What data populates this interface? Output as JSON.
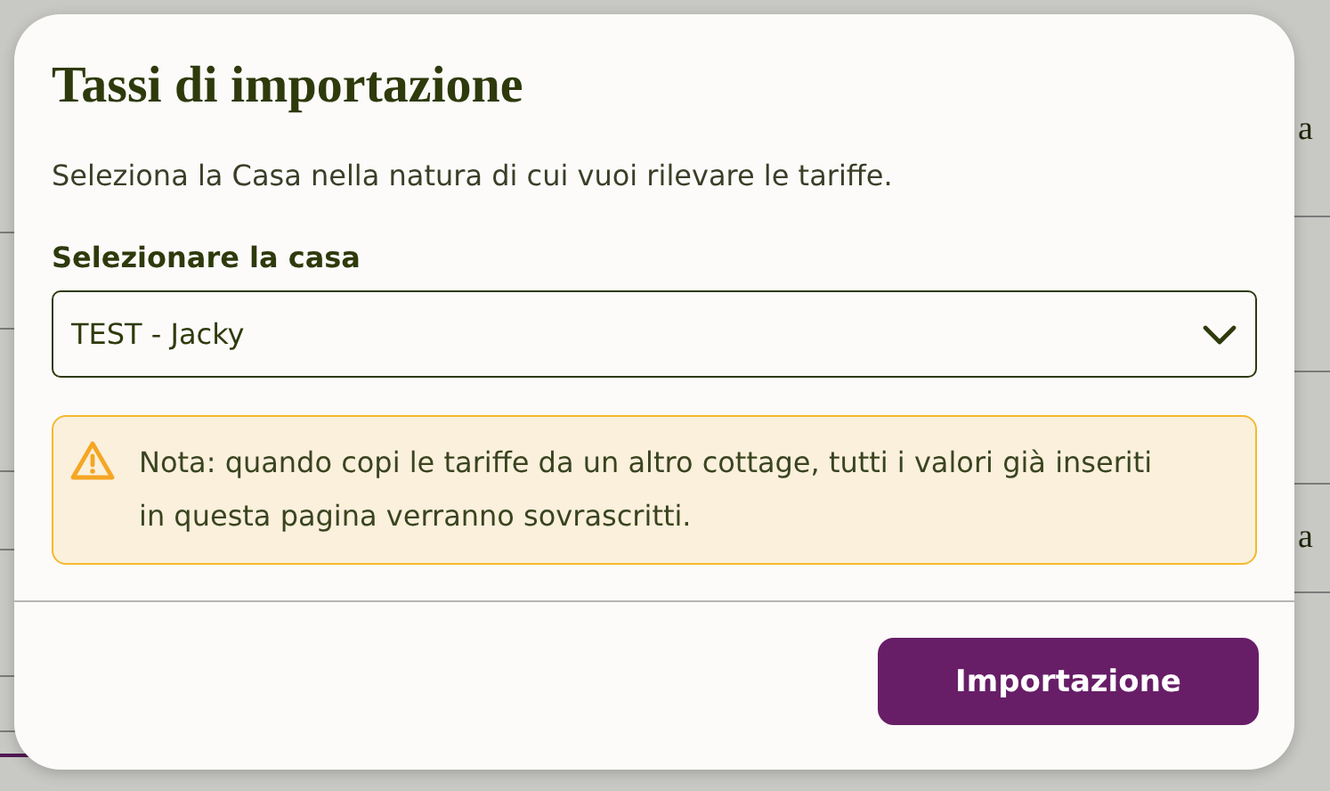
{
  "background": {
    "right_rows": [
      {
        "text": "a"
      },
      {},
      {},
      {
        "text": "a"
      }
    ]
  },
  "dialog": {
    "title": "Tassi di importazione",
    "description": "Seleziona la Casa nella natura di cui vuoi rilevare le tariffe.",
    "select": {
      "label": "Selezionare la casa",
      "value": "TEST - Jacky"
    },
    "note": "Nota: quando copi le tariffe da un altro cottage, tutti i valori già inseriti in questa pagina verranno sovrascritti.",
    "button": "Importazione"
  }
}
